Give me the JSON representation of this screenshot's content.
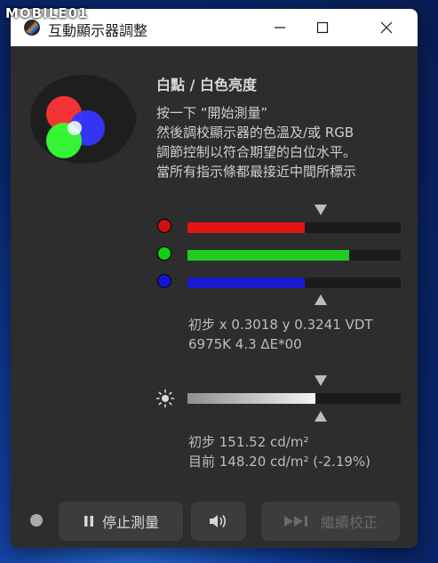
{
  "watermark": "MOBILE01",
  "window": {
    "title": "互動顯示器調整",
    "controls": [
      "minimize",
      "maximize",
      "close"
    ]
  },
  "panel": {
    "heading": "白點 / 白色亮度",
    "instructions": [
      "按一下 “開始測量”",
      "然後調校顯示器的色溫及/或 RGB",
      "調節控制以符合期望的白位水平。",
      "當所有指示條都最接近中間所標示"
    ]
  },
  "rgb_bars": [
    {
      "name": "red",
      "color": "#d01010",
      "fill_color": "#e01414",
      "level_fraction": 0.55
    },
    {
      "name": "green",
      "color": "#14d014",
      "fill_color": "#22cc22",
      "level_fraction": 0.76
    },
    {
      "name": "blue",
      "color": "#1414d0",
      "fill_color": "#1a1ad0",
      "level_fraction": 0.55
    }
  ],
  "rgb_readout": {
    "line1": "初步 x 0.3018 y 0.3241 VDT",
    "line2": "6975K 4.3 ΔE*00"
  },
  "brightness": {
    "icon": "sun-icon",
    "level_fraction": 0.6,
    "line1": "初步 151.52 cd/m²",
    "line2": "目前 148.20 cd/m² (-2.19%)"
  },
  "footer": {
    "status_color": "#a9a9a9",
    "stop_label": "停止測量",
    "sound_icon": "speaker-icon",
    "continue_label": "繼續校正"
  }
}
